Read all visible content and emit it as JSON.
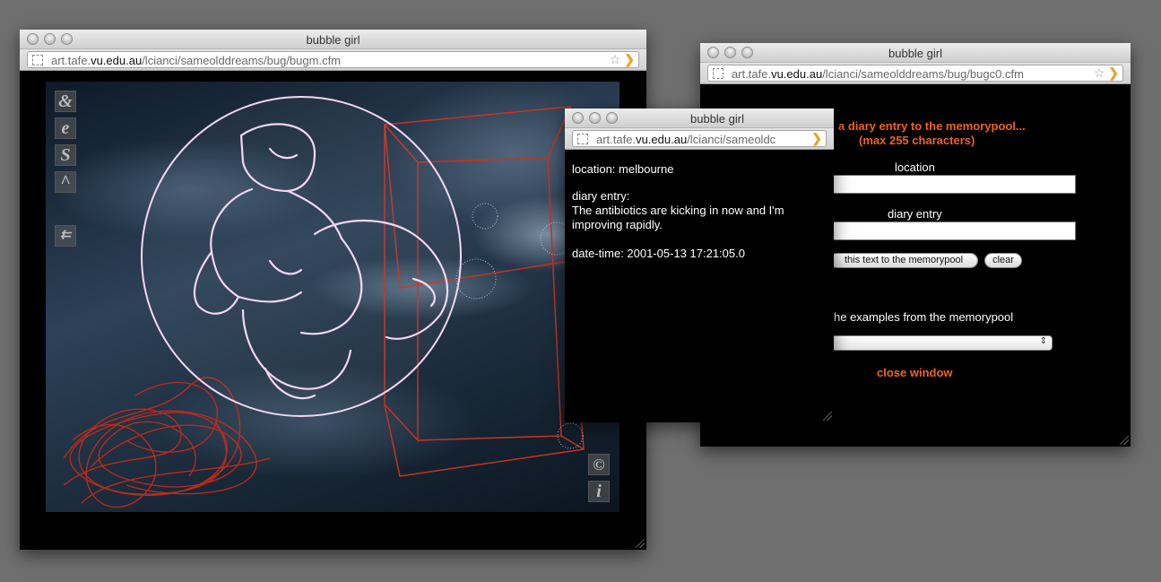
{
  "windows": {
    "main": {
      "title": "bubble girl",
      "url_host_pre": "art.tafe.",
      "url_host_bold": "vu.edu.au",
      "url_path": "/lcianci/sameolddreams/bug/bugm.cfm",
      "side_icons": [
        "&",
        "e",
        "S",
        "^",
        "back"
      ],
      "corner_icons": [
        "©",
        "i"
      ]
    },
    "memorypool": {
      "title": "bubble girl",
      "url_host_pre": "art.tafe.",
      "url_host_bold": "vu.edu.au",
      "url_path": "/lcianci/sameolddreams/bug/bugc0.cfm",
      "heading": "a diary entry to the memorypool...",
      "subheading": "(max 255 characters)",
      "location_label": "location",
      "location_value": "",
      "diary_label": "diary entry",
      "diary_value": "",
      "submit_label": "this text to the memorypool",
      "clear_label": "clear",
      "examples_label": "he examples from the memorypool",
      "examples_selected": "",
      "close_label": "close window"
    },
    "entry": {
      "title": "bubble girl",
      "url_host_pre": "art.tafe.",
      "url_host_bold": "vu.edu.au",
      "url_path": "/lcianci/sameoldc",
      "location": "location: melbourne",
      "diary_label": "diary entry:",
      "diary_text": "The antibiotics are kicking in now and I'm improving rapidly.",
      "datetime": "date-time: 2001-05-13 17:21:05.0"
    }
  },
  "colors": {
    "accent_orange": "#f0631a",
    "bubble_outline": "#f5d6f0",
    "scribble_red": "#d42a14",
    "desktop": "#6f6f6f"
  }
}
